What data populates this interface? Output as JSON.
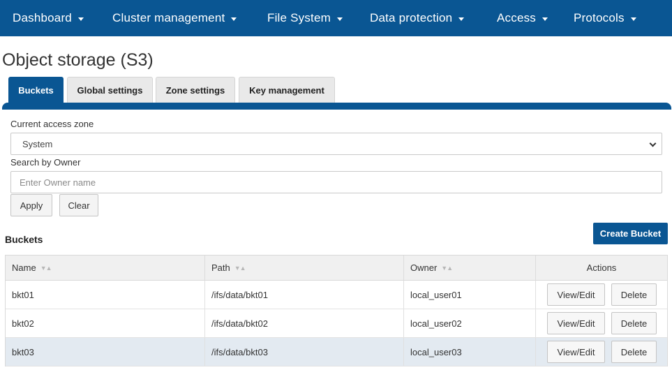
{
  "nav": {
    "items": [
      {
        "label": "Dashboard"
      },
      {
        "label": "Cluster management"
      },
      {
        "label": "File System"
      },
      {
        "label": "Data protection"
      },
      {
        "label": "Access"
      },
      {
        "label": "Protocols"
      }
    ]
  },
  "page": {
    "title": "Object storage (S3)"
  },
  "tabs": [
    {
      "label": "Buckets",
      "active": true
    },
    {
      "label": "Global settings",
      "active": false
    },
    {
      "label": "Zone settings",
      "active": false
    },
    {
      "label": "Key management",
      "active": false
    }
  ],
  "filters": {
    "zone_label": "Current access zone",
    "zone_value": "System",
    "owner_label": "Search by Owner",
    "owner_placeholder": "Enter Owner name",
    "owner_value": "",
    "apply_label": "Apply",
    "clear_label": "Clear"
  },
  "buckets": {
    "section_title": "Buckets",
    "create_label": "Create Bucket",
    "columns": [
      "Name",
      "Path",
      "Owner",
      "Actions"
    ],
    "rows": [
      {
        "name": "bkt01",
        "path": "/ifs/data/bkt01",
        "owner": "local_user01"
      },
      {
        "name": "bkt02",
        "path": "/ifs/data/bkt02",
        "owner": "local_user02"
      },
      {
        "name": "bkt03",
        "path": "/ifs/data/bkt03",
        "owner": "local_user03"
      }
    ],
    "view_label": "View/Edit",
    "delete_label": "Delete"
  },
  "colors": {
    "nav_bg": "#0a5693",
    "accent": "#0a5693",
    "row_highlight": "#e3eaf1"
  },
  "icons": {
    "nav_dropdown": "caret-down-icon",
    "select_dropdown": "chevron-down-icon",
    "column_sort": "sort-icon"
  }
}
